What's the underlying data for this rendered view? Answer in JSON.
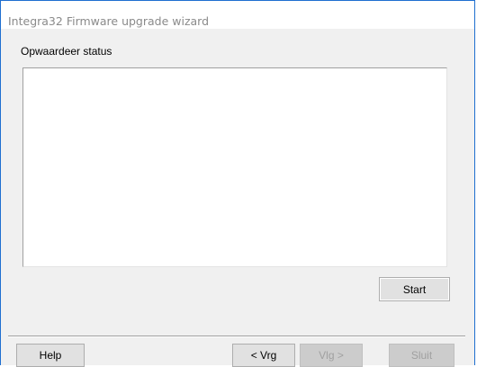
{
  "window": {
    "title": "Integra32 Firmware upgrade wizard"
  },
  "main": {
    "section_label": "Opwaardeer status",
    "status_text": ""
  },
  "buttons": {
    "start": "Start",
    "help": "Help",
    "prev": "< Vrg",
    "next": "Vlg >",
    "close": "Sluit"
  },
  "colors": {
    "window_border": "#1f6fd0",
    "dialog_background": "#f0f0f0",
    "button_background": "#e1e1e1",
    "disabled_text": "#a0a0a0"
  }
}
